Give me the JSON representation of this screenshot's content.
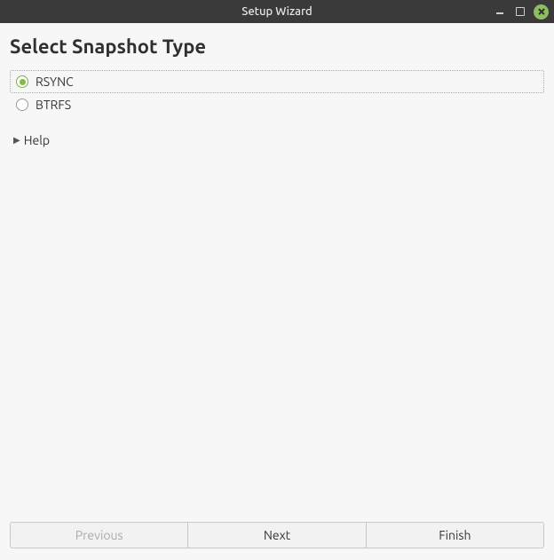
{
  "window": {
    "title": "Setup Wizard"
  },
  "page": {
    "heading": "Select Snapshot Type"
  },
  "options": {
    "rsync": {
      "label": "RSYNC",
      "selected": true
    },
    "btrfs": {
      "label": "BTRFS",
      "selected": false
    }
  },
  "help": {
    "label": "Help",
    "expanded": false
  },
  "buttons": {
    "previous": {
      "label": "Previous",
      "enabled": false
    },
    "next": {
      "label": "Next",
      "enabled": true
    },
    "finish": {
      "label": "Finish",
      "enabled": true
    }
  }
}
